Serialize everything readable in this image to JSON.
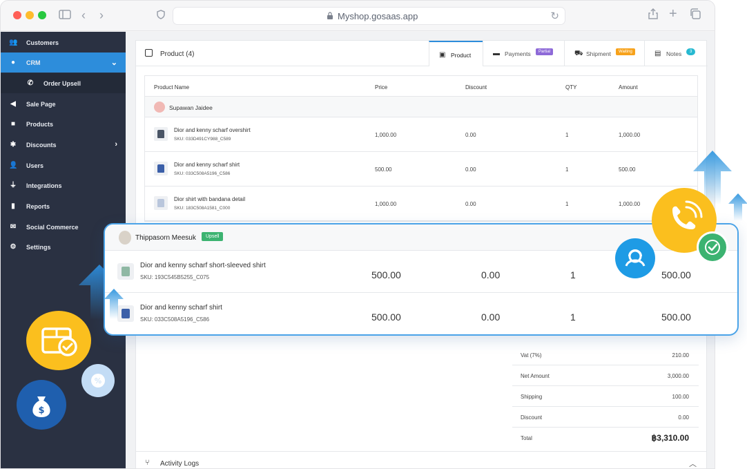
{
  "browser": {
    "url": "Myshop.gosaas.app"
  },
  "sidebar": {
    "items": [
      {
        "label": "Customers",
        "icon": "users-icon"
      },
      {
        "label": "CRM",
        "icon": "crm-icon"
      },
      {
        "label": "Order Upsell",
        "icon": "phone-icon"
      },
      {
        "label": "Sale Page",
        "icon": "megaphone-icon"
      },
      {
        "label": "Products",
        "icon": "box-icon"
      },
      {
        "label": "Discounts",
        "icon": "discount-icon"
      },
      {
        "label": "Users",
        "icon": "user-icon"
      },
      {
        "label": "Integrations",
        "icon": "plug-icon"
      },
      {
        "label": "Reports",
        "icon": "chart-icon"
      },
      {
        "label": "Social Commerce",
        "icon": "chat-icon"
      },
      {
        "label": "Settings",
        "icon": "gear-icon"
      }
    ]
  },
  "card": {
    "title": "Product (4)",
    "tabs": [
      {
        "label": "Product"
      },
      {
        "label": "Payments",
        "badge": "Partial"
      },
      {
        "label": "Shipment",
        "badge": "Waiting"
      },
      {
        "label": "Notes",
        "badge": "3"
      }
    ]
  },
  "table": {
    "headers": [
      "Product Name",
      "Price",
      "Discount",
      "QTY",
      "Amount"
    ],
    "customer": "Supawan Jaidee",
    "rows": [
      {
        "name": "Dior and kenny scharf overshirt",
        "sku": "SKU: 033D491CY988_C589",
        "price": "1,000.00",
        "discount": "0.00",
        "qty": "1",
        "amount": "1,000.00"
      },
      {
        "name": "Dior and kenny scharf shirt",
        "sku": "SKU: 033C508A5196_C586",
        "price": "500.00",
        "discount": "0.00",
        "qty": "1",
        "amount": "500.00"
      },
      {
        "name": "Dior shirt with bandana detail",
        "sku": "SKU: 183C508A1581_C000",
        "price": "1,000.00",
        "discount": "0.00",
        "qty": "1",
        "amount": "1,000.00"
      }
    ]
  },
  "upsell": {
    "customer": "Thippasorn Meesuk",
    "badge": "Upsell",
    "rows": [
      {
        "name": "Dior and kenny scharf short-sleeved shirt",
        "sku": "SKU: 193C545B5255_C075",
        "price": "500.00",
        "discount": "0.00",
        "qty": "1",
        "amount": "500.00"
      },
      {
        "name": "Dior and kenny scharf shirt",
        "sku": "SKU: 033C508A5196_C586",
        "price": "500.00",
        "discount": "0.00",
        "qty": "1",
        "amount": "500.00"
      }
    ]
  },
  "summary": [
    {
      "label": "Vat (7%)",
      "value": "210.00"
    },
    {
      "label": "Net Amount",
      "value": "3,000.00"
    },
    {
      "label": "Shipping",
      "value": "100.00"
    },
    {
      "label": "Discount",
      "value": "0.00"
    },
    {
      "label": "Total",
      "value": "฿3,310.00"
    }
  ],
  "activity": {
    "label": "Activity Logs"
  },
  "colors": {
    "accent": "#2d8ddb",
    "sidebar": "#2a3142",
    "upsell_border": "#4aa3e8",
    "yellow": "#fbbf1e",
    "green": "#3cb371"
  }
}
